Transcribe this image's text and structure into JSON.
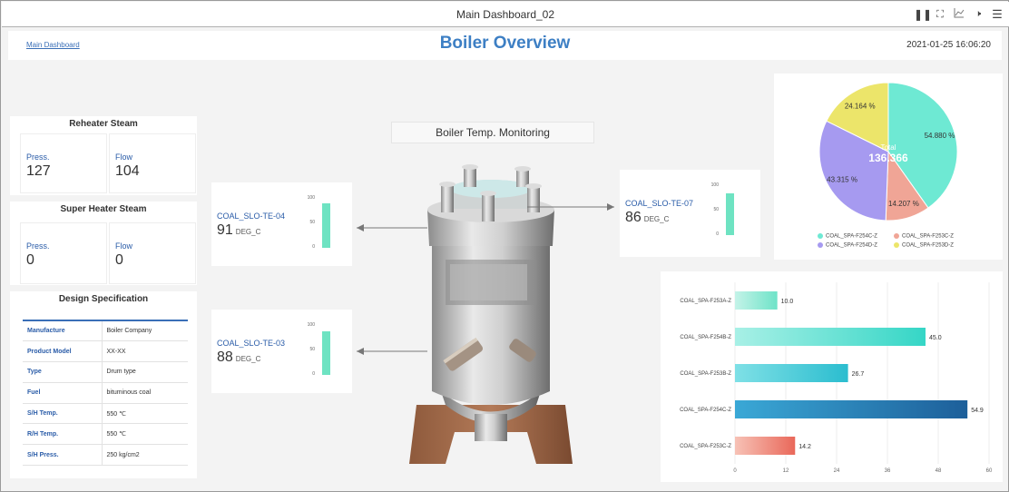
{
  "window": {
    "title": "Main Dashboard_02",
    "controls": [
      "pause-icon",
      "fullscreen-icon",
      "chart-icon",
      "speaker-icon",
      "menu-icon"
    ]
  },
  "header": {
    "breadcrumb": "Main Dashboard",
    "title": "Boiler Overview",
    "timestamp": "2021-01-25 16:06:20"
  },
  "reheater": {
    "title": "Reheater Steam",
    "press_label": "Press.",
    "press_value": "127",
    "flow_label": "Flow",
    "flow_value": "104"
  },
  "superheater": {
    "title": "Super Heater Steam",
    "press_label": "Press.",
    "press_value": "0",
    "flow_label": "Flow",
    "flow_value": "0"
  },
  "design": {
    "title": "Design Specification",
    "rows": [
      {
        "key": "Manufacture",
        "value": "Boiler Company"
      },
      {
        "key": "Product Model",
        "value": "XX-XX"
      },
      {
        "key": "Type",
        "value": "Drum type"
      },
      {
        "key": "Fuel",
        "value": "bituminous coal"
      },
      {
        "key": "S/H Temp.",
        "value": "550 ℃"
      },
      {
        "key": "R/H Temp.",
        "value": "550 ℃"
      },
      {
        "key": "S/H Press.",
        "value": "250 kg/cm2"
      }
    ]
  },
  "monitoring_title": "Boiler Temp. Monitoring",
  "sensors": {
    "te04": {
      "name": "COAL_SLO-TE-04",
      "value": "91",
      "unit": "DEG_C",
      "level": 91
    },
    "te03": {
      "name": "COAL_SLO-TE-03",
      "value": "88",
      "unit": "DEG_C",
      "level": 88
    },
    "te07": {
      "name": "COAL_SLO-TE-07",
      "value": "86",
      "unit": "DEG_C",
      "level": 86
    },
    "gauge_ticks": [
      "100",
      "50",
      "0"
    ]
  },
  "colors": {
    "accent": "#3d7fc4",
    "gauge": "#6ee3c2",
    "label": "#2a5ca8"
  },
  "chart_data": [
    {
      "type": "pie",
      "center_label": "Total",
      "center_value": "136.366",
      "categories": [
        "COAL_SPA-F254C-Z",
        "COAL_SPA-F253C-Z",
        "COAL_SPA-F254D-Z",
        "COAL_SPA-F253D-Z"
      ],
      "values": [
        54.88,
        14.207,
        43.315,
        24.164
      ],
      "labels": [
        "54.880 %",
        "14.207 %",
        "43.315 %",
        "24.164 %"
      ],
      "colors": [
        "#6ee9d3",
        "#f0a596",
        "#a69af0",
        "#ece56a"
      ],
      "legend": "bottom"
    },
    {
      "type": "bar",
      "orientation": "horizontal",
      "categories": [
        "COAL_SPA-F253A-Z",
        "COAL_SPA-F254B-Z",
        "COAL_SPA-F253B-Z",
        "COAL_SPA-F254C-Z",
        "COAL_SPA-F253C-Z"
      ],
      "values": [
        10.0,
        45.0,
        26.7,
        54.9,
        14.2
      ],
      "value_labels": [
        "10.0",
        "45.0",
        "26.7",
        "54.9",
        "14.2"
      ],
      "colors": [
        [
          "#c4f3e8",
          "#6ee3c8"
        ],
        [
          "#a8f0e6",
          "#35d6c6"
        ],
        [
          "#7fe0e6",
          "#2bbdcf"
        ],
        [
          "#3aa8d6",
          "#1d5f9a"
        ],
        [
          "#f7c2b6",
          "#e9685a"
        ]
      ],
      "xlim": [
        0,
        60
      ],
      "xticks": [
        "0",
        "12",
        "24",
        "36",
        "48",
        "60"
      ],
      "grid": true
    }
  ]
}
